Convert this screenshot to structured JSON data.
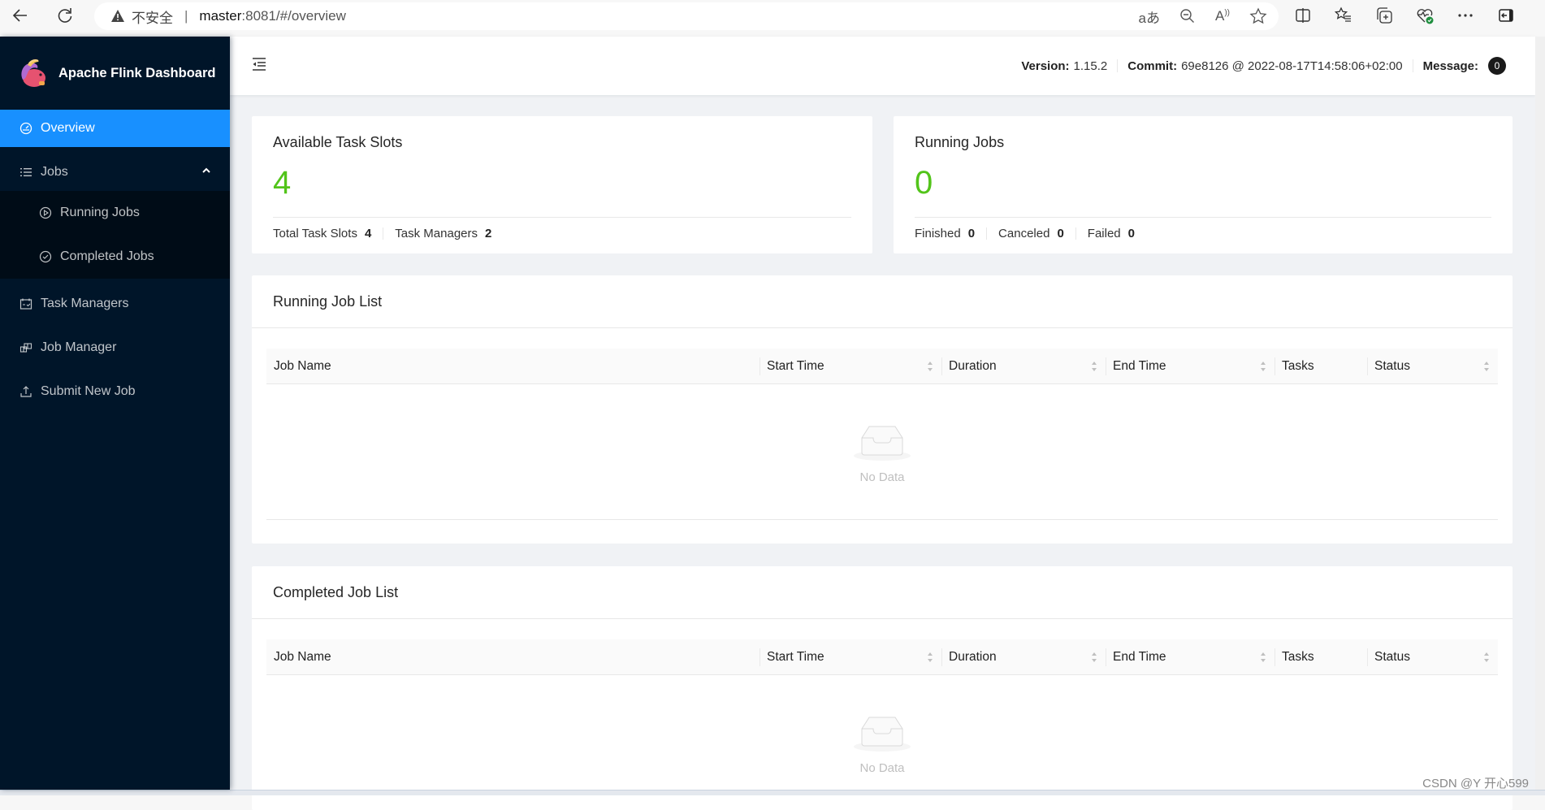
{
  "browser": {
    "security_label": "不安全",
    "url_host": "master",
    "url_path": ":8081/#/overview",
    "address_icons": [
      "translate-icon",
      "zoom-out-icon",
      "read-aloud-icon",
      "favorite-star-icon"
    ],
    "toolbar_icons": [
      "split-screen-icon",
      "favorites-list-icon",
      "collections-icon",
      "browser-essentials-icon",
      "more-icon",
      "sidebar-toggle-icon"
    ]
  },
  "sidebar": {
    "app_title": "Apache Flink Dashboard",
    "items": [
      {
        "label": "Overview",
        "icon": "dashboard-icon",
        "active": true
      },
      {
        "label": "Jobs",
        "icon": "list-icon",
        "expanded": true,
        "children": [
          {
            "label": "Running Jobs",
            "icon": "play-circle-icon"
          },
          {
            "label": "Completed Jobs",
            "icon": "check-circle-icon"
          }
        ]
      },
      {
        "label": "Task Managers",
        "icon": "schedule-icon"
      },
      {
        "label": "Job Manager",
        "icon": "build-icon"
      },
      {
        "label": "Submit New Job",
        "icon": "upload-icon"
      }
    ]
  },
  "header": {
    "version_label": "Version:",
    "version_value": "1.15.2",
    "commit_label": "Commit:",
    "commit_value": "69e8126 @ 2022-08-17T14:58:06+02:00",
    "message_label": "Message:",
    "message_count": "0"
  },
  "stats": {
    "task_slots": {
      "title": "Available Task Slots",
      "value": "4",
      "footer": [
        {
          "label": "Total Task Slots",
          "value": "4"
        },
        {
          "label": "Task Managers",
          "value": "2"
        }
      ]
    },
    "running_jobs": {
      "title": "Running Jobs",
      "value": "0",
      "footer": [
        {
          "label": "Finished",
          "value": "0"
        },
        {
          "label": "Canceled",
          "value": "0"
        },
        {
          "label": "Failed",
          "value": "0"
        }
      ]
    }
  },
  "running_list": {
    "title": "Running Job List",
    "columns": [
      "Job Name",
      "Start Time",
      "Duration",
      "End Time",
      "Tasks",
      "Status"
    ],
    "rows": [],
    "empty_text": "No Data"
  },
  "completed_list": {
    "title": "Completed Job List",
    "columns": [
      "Job Name",
      "Start Time",
      "Duration",
      "End Time",
      "Tasks",
      "Status"
    ],
    "rows": [],
    "empty_text": "No Data"
  },
  "watermark": "CSDN @Y 开心599",
  "colors": {
    "sidebar_bg": "#001529",
    "active_item": "#1890ff",
    "stat_value": "#52c41a"
  }
}
